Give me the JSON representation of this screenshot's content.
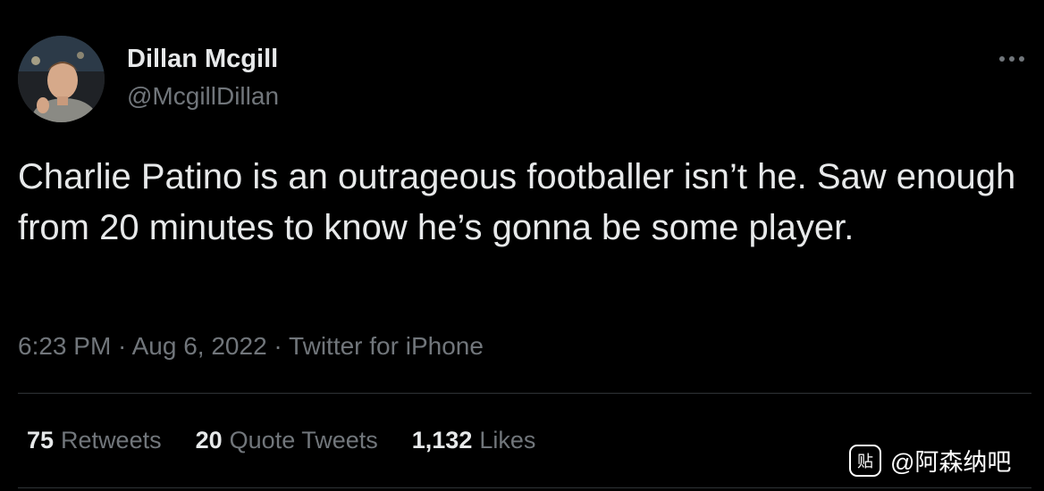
{
  "author": {
    "name": "Dillan Mcgill",
    "handle": "@McgillDillan"
  },
  "tweet": {
    "text": "Charlie Patino is an outrageous footballer isn’t he. Saw enough from 20 minutes to know he’s gonna be some player.",
    "time": "6:23 PM",
    "date": "Aug 6, 2022",
    "source": "Twitter for iPhone",
    "separator": " · "
  },
  "stats": {
    "retweets_count": "75",
    "retweets_label": "Retweets",
    "quotes_count": "20",
    "quotes_label": "Quote Tweets",
    "likes_count": "1,132",
    "likes_label": "Likes"
  },
  "watermark": {
    "icon_glyph": "贴",
    "text": "@阿森纳吧"
  },
  "icons": {
    "more": "more-horizontal-icon",
    "avatar": "profile-photo"
  },
  "colors": {
    "background": "#000000",
    "primary_text": "#e7e9ea",
    "secondary_text": "#71767b",
    "divider": "#2f3336"
  }
}
